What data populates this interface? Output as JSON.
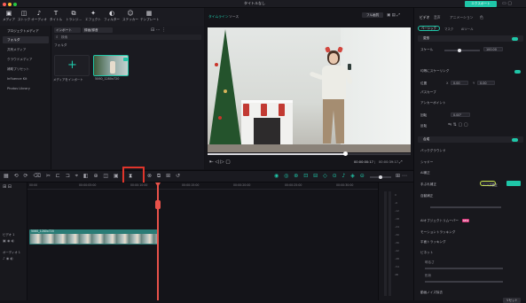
{
  "titlebar": {
    "title": "タイトルなし",
    "export": "エクスポート"
  },
  "toolbar": {
    "items": [
      {
        "icon": "media-icon",
        "label": "メディア"
      },
      {
        "icon": "stock-icon",
        "label": "ストック"
      },
      {
        "icon": "audio-icon",
        "label": "オーディオ"
      },
      {
        "icon": "title-icon",
        "label": "タイトル"
      },
      {
        "icon": "transition-icon",
        "label": "トランジ..."
      },
      {
        "icon": "effect-icon",
        "label": "エフェクト"
      },
      {
        "icon": "filter-icon",
        "label": "フィルター"
      },
      {
        "icon": "sticker-icon",
        "label": "ステッカー"
      },
      {
        "icon": "template-icon",
        "label": "テンプレート"
      }
    ]
  },
  "sidebar": {
    "items": [
      "プロジェクトメディア",
      "フォルダ",
      "共有メディア",
      "クラウドメディア",
      "補助プリセット",
      "Influence Kit",
      "Photos Library"
    ]
  },
  "media": {
    "import_label": "インポート",
    "record_label": "録画/録音",
    "search_placeholder": "検索",
    "folder_label": "フォルダ",
    "import_tile_label": "メディアをインポート",
    "clip_name": "5060_1280x720"
  },
  "preview": {
    "tab_timeline": "タイムライン",
    "tab_source": "ソース",
    "quality": "フル画質",
    "time_current": "00:00:00:17",
    "time_total": "00:00:39:17"
  },
  "properties": {
    "tabs": [
      "ビデオ",
      "音声",
      "アニメーション",
      "色"
    ],
    "subtabs": [
      "ベーシック",
      "マスク",
      "AIツール"
    ],
    "sections": [
      "変形",
      "スケール",
      "均等にスケーリング",
      "位置",
      "X",
      "Y",
      "パスカーブ",
      "アンカーポイント",
      "回転",
      "反転",
      "合成",
      "バックグラウンド",
      "シャドー",
      "AI補正",
      "手ぶれ補正",
      "自動補正",
      "AIオブジェクトリムーバー",
      "モーショントラッキング",
      "平面トラッキング",
      "ビネット",
      "明るさ",
      "形状",
      "動画ノイズ除去"
    ],
    "scale_value": "100.00",
    "x_value": "0.00",
    "y_value": "0.00",
    "rotate_value": "0.00°",
    "new_badge": "NEW",
    "lens_label": "レンズ補正",
    "reset_label": "リセット"
  },
  "timeline": {
    "ruler": [
      "00:00",
      "00:00:05:00",
      "00:00:10:00",
      "00:00:15:00",
      "00:00:20:00",
      "00:00:25:00",
      "00:00:30:00"
    ],
    "track_video": "ビデオ 1",
    "track_audio": "オーディオ 1",
    "clip_title": "5060_1280x720"
  },
  "colors": {
    "accent": "#1fc6a8",
    "highlight": "#e0352b",
    "playhead": "#e8524a",
    "clip": "#2a7c76"
  }
}
